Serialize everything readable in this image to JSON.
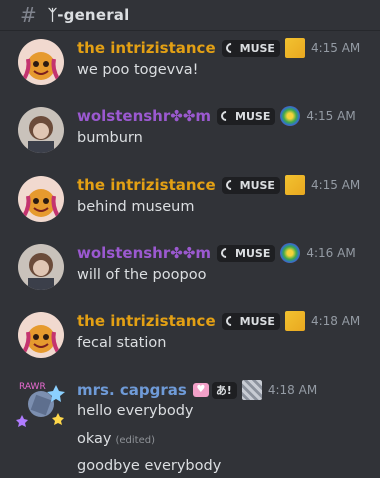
{
  "channel": {
    "name": "ᛉ-general",
    "icon": "hash-icon"
  },
  "colors": {
    "gold": "#e3a014",
    "purple": "#9b59d0",
    "blue": "#6f9bd8"
  },
  "messages": [
    {
      "username": "the intrizistance",
      "tag": "MUSE",
      "time": "4:15 AM",
      "text": "we poo togevva!"
    },
    {
      "username": "wolstenshr✤✤m",
      "tag": "MUSE",
      "time": "4:15 AM",
      "text": "bumburn"
    },
    {
      "username": "the intrizistance",
      "tag": "MUSE",
      "time": "4:15 AM",
      "text": "behind museum"
    },
    {
      "username": "wolstenshr✤✤m",
      "tag": "MUSE",
      "time": "4:16 AM",
      "text": "will of the poopoo"
    },
    {
      "username": "the intrizistance",
      "tag": "MUSE",
      "time": "4:18 AM",
      "text": "fecal station"
    },
    {
      "username": "mrs. capgras",
      "tag": "あ!",
      "time": "4:18 AM",
      "lines": [
        "hello everybody",
        "okay",
        "goodbye everybody"
      ],
      "edited_label": "(edited)"
    }
  ]
}
